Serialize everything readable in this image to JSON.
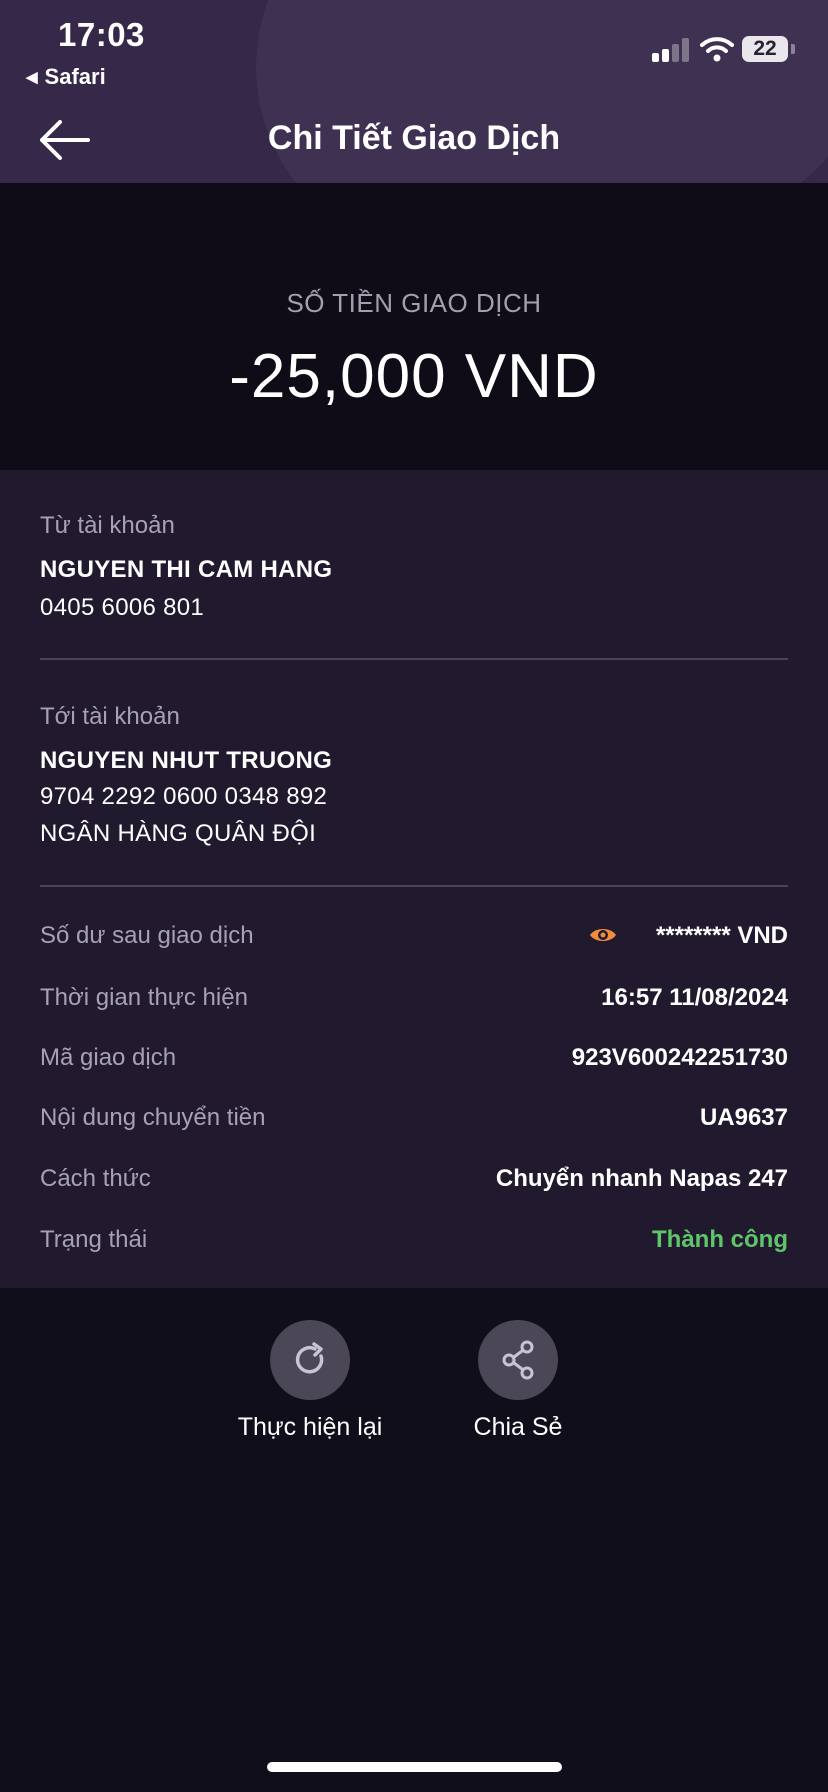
{
  "status_bar": {
    "time": "17:03",
    "back_app": "Safari",
    "battery": "22"
  },
  "header": {
    "title": "Chi Tiết Giao Dịch"
  },
  "amount": {
    "label": "SỐ TIỀN GIAO DỊCH",
    "value": "-25,000 VND"
  },
  "from_account": {
    "label": "Từ tài khoản",
    "name": "NGUYEN THI CAM HANG",
    "number": "0405 6006 801"
  },
  "to_account": {
    "label": "Tới tài khoản",
    "name": "NGUYEN NHUT TRUONG",
    "number": "9704 2292 0600 0348 892",
    "bank": "NGÂN HÀNG QUÂN ĐỘI"
  },
  "details": [
    {
      "label": "Số dư sau giao dịch",
      "value": "******** VND",
      "icon": "eye-icon"
    },
    {
      "label": "Thời gian thực hiện",
      "value": "16:57 11/08/2024"
    },
    {
      "label": "Mã giao dịch",
      "value": "923V600242251730"
    },
    {
      "label": "Nội dung chuyển tiền",
      "value": "UA9637"
    },
    {
      "label": "Cách thức",
      "value": "Chuyển nhanh Napas 247"
    },
    {
      "label": "Trạng thái",
      "value": "Thành công",
      "status_color": "#5fc56b"
    }
  ],
  "actions": {
    "repeat": {
      "label": "Thực hiện lại",
      "icon": "refresh-icon"
    },
    "share": {
      "label": "Chia Sẻ",
      "icon": "share-icon"
    }
  },
  "colors": {
    "header_bg": "#362848",
    "panel_bg": "#211a2e",
    "accent_eye": "#f08c3a",
    "success": "#5fc56b"
  }
}
